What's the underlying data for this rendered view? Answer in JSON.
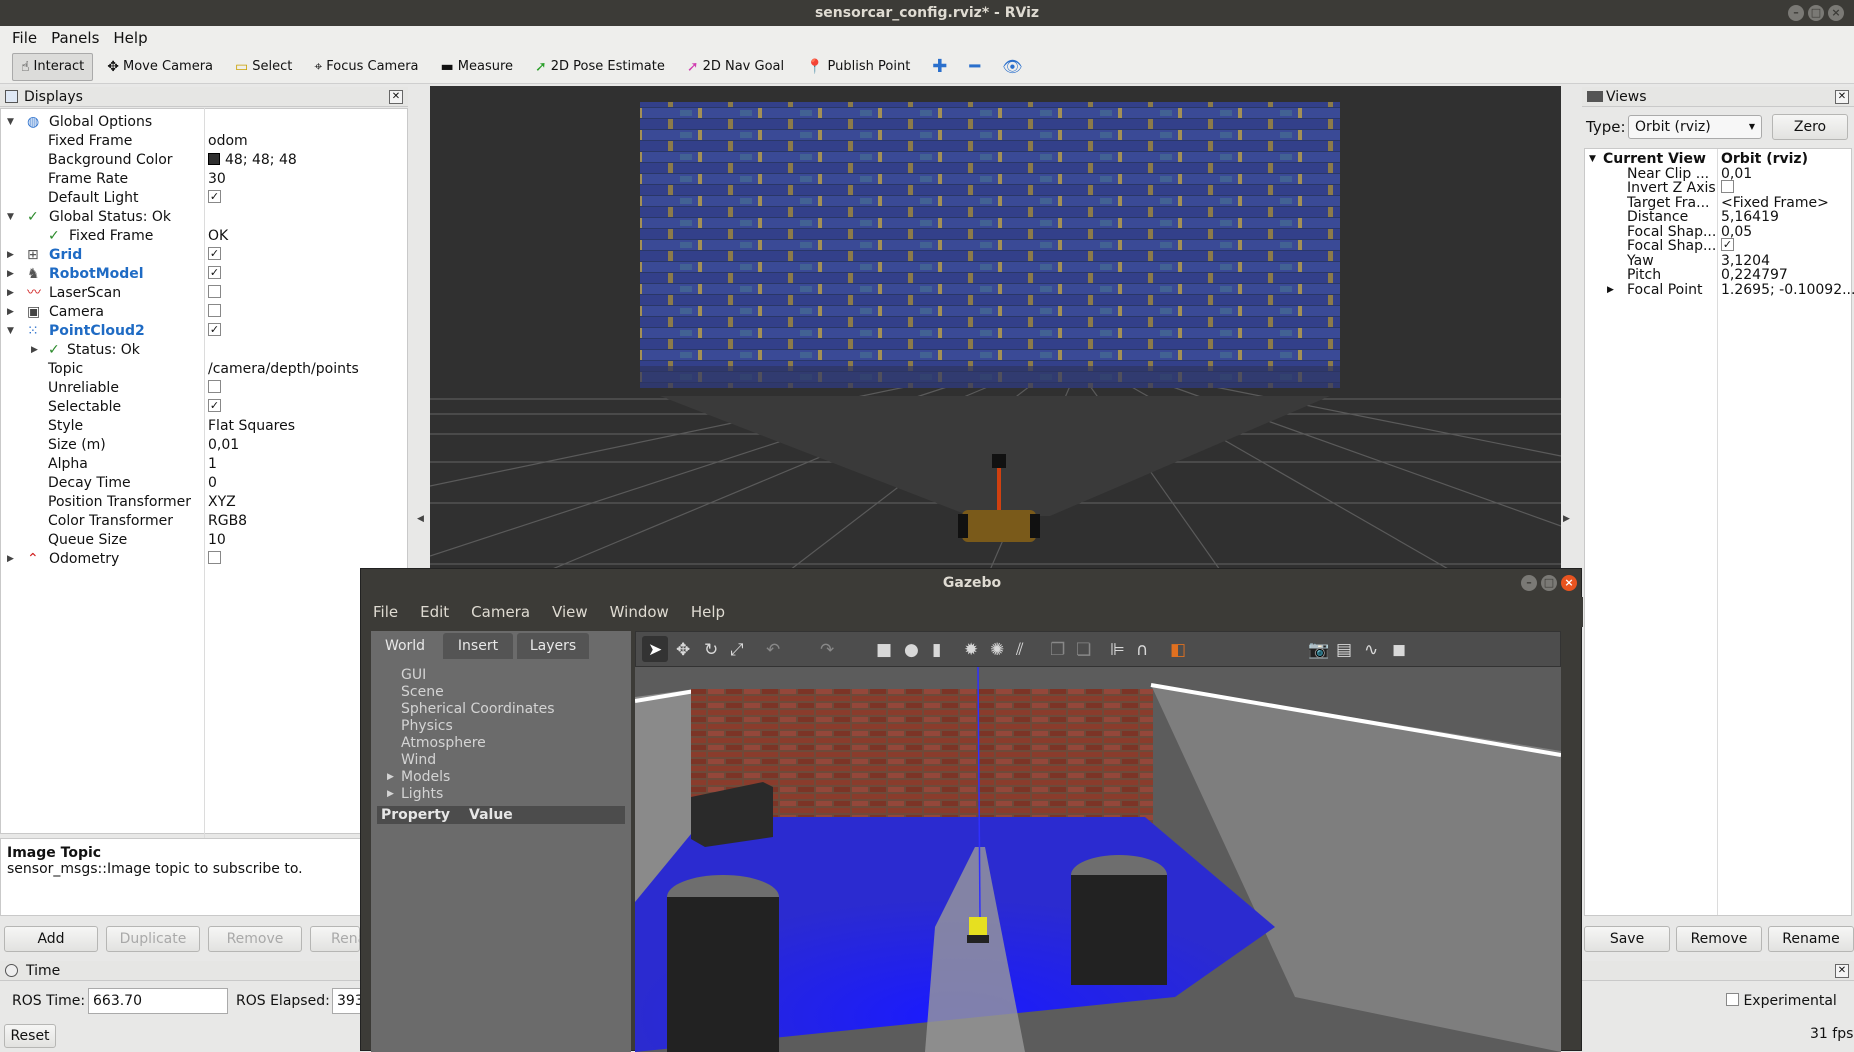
{
  "window": {
    "title": "sensorcar_config.rviz* - RViz"
  },
  "menu": [
    "File",
    "Panels",
    "Help"
  ],
  "toolbar": [
    {
      "label": "Interact",
      "icon": "cursor-icon",
      "active": true
    },
    {
      "label": "Move Camera",
      "icon": "move-icon"
    },
    {
      "label": "Select",
      "icon": "select-icon"
    },
    {
      "label": "Focus Camera",
      "icon": "focus-icon"
    },
    {
      "label": "Measure",
      "icon": "ruler-icon"
    },
    {
      "label": "2D Pose Estimate",
      "icon": "green-arrow-icon"
    },
    {
      "label": "2D Nav Goal",
      "icon": "pink-arrow-icon"
    },
    {
      "label": "Publish Point",
      "icon": "pin-icon"
    }
  ],
  "displays": {
    "title": "Displays",
    "rows": [
      {
        "label": "Global Options",
        "value": "",
        "indent": 0,
        "arrow": "down",
        "icon": "globe-icon"
      },
      {
        "label": "Fixed Frame",
        "value": "odom",
        "indent": 1
      },
      {
        "label": "Background Color",
        "value": "48; 48; 48",
        "indent": 1,
        "swatch": "#303030"
      },
      {
        "label": "Frame Rate",
        "value": "30",
        "indent": 1
      },
      {
        "label": "Default Light",
        "value": "",
        "indent": 1,
        "check": true
      },
      {
        "label": "Global Status: Ok",
        "value": "",
        "indent": 0,
        "arrow": "down",
        "status": true
      },
      {
        "label": "Fixed Frame",
        "value": "OK",
        "indent": 2,
        "status": true
      },
      {
        "label": "Grid",
        "value": "",
        "indent": 0,
        "arrow": "right",
        "icon": "grid-icon",
        "blue": true,
        "check": true
      },
      {
        "label": "RobotModel",
        "value": "",
        "indent": 0,
        "arrow": "right",
        "icon": "robot-icon",
        "blue": true,
        "check": true
      },
      {
        "label": "LaserScan",
        "value": "",
        "indent": 0,
        "arrow": "right",
        "icon": "laser-icon",
        "check": false
      },
      {
        "label": "Camera",
        "value": "",
        "indent": 0,
        "arrow": "right",
        "icon": "camera-icon",
        "check": false
      },
      {
        "label": "PointCloud2",
        "value": "",
        "indent": 0,
        "arrow": "down",
        "icon": "pointcloud-icon",
        "blue": true,
        "check": true
      },
      {
        "label": "Status: Ok",
        "value": "",
        "indent": 1,
        "arrow": "right",
        "status": true
      },
      {
        "label": "Topic",
        "value": "/camera/depth/points",
        "indent": 1
      },
      {
        "label": "Unreliable",
        "value": "",
        "indent": 1,
        "check": false
      },
      {
        "label": "Selectable",
        "value": "",
        "indent": 1,
        "check": true
      },
      {
        "label": "Style",
        "value": "Flat Squares",
        "indent": 1
      },
      {
        "label": "Size (m)",
        "value": "0,01",
        "indent": 1
      },
      {
        "label": "Alpha",
        "value": "1",
        "indent": 1
      },
      {
        "label": "Decay Time",
        "value": "0",
        "indent": 1
      },
      {
        "label": "Position Transformer",
        "value": "XYZ",
        "indent": 1
      },
      {
        "label": "Color Transformer",
        "value": "RGB8",
        "indent": 1
      },
      {
        "label": "Queue Size",
        "value": "10",
        "indent": 1
      },
      {
        "label": "Odometry",
        "value": "",
        "indent": 0,
        "arrow": "right",
        "icon": "odometry-icon",
        "check": false
      }
    ],
    "desc_title": "Image Topic",
    "desc_text": "sensor_msgs::Image topic to subscribe to.",
    "buttons": [
      "Add",
      "Duplicate",
      "Remove",
      "Rena"
    ]
  },
  "views": {
    "title": "Views",
    "type_label": "Type:",
    "type_value": "Orbit (rviz)",
    "zero": "Zero",
    "rows": [
      {
        "label": "Current View",
        "value": "Orbit (rviz)",
        "bold": true,
        "arrow": "down"
      },
      {
        "label": "Near Clip ...",
        "value": "0,01"
      },
      {
        "label": "Invert Z Axis",
        "value": "",
        "check": false
      },
      {
        "label": "Target Fra...",
        "value": "<Fixed Frame>"
      },
      {
        "label": "Distance",
        "value": "5,16419"
      },
      {
        "label": "Focal Shap...",
        "value": "0,05"
      },
      {
        "label": "Focal Shap...",
        "value": "",
        "check": true
      },
      {
        "label": "Yaw",
        "value": "3,1204"
      },
      {
        "label": "Pitch",
        "value": "0,224797"
      },
      {
        "label": "Focal Point",
        "value": "1.2695; -0.10092...",
        "arrow": "right"
      }
    ],
    "buttons": [
      "Save",
      "Remove",
      "Rename"
    ]
  },
  "time": {
    "title": "Time",
    "ros_time_label": "ROS Time:",
    "ros_time": "663.70",
    "ros_elapsed_label": "ROS Elapsed:",
    "ros_elapsed": "393",
    "experimental": "Experimental",
    "reset": "Reset",
    "fps": "31 fps"
  },
  "gazebo": {
    "title": "Gazebo",
    "menu": [
      "File",
      "Edit",
      "Camera",
      "View",
      "Window",
      "Help"
    ],
    "tabs": [
      "World",
      "Insert",
      "Layers"
    ],
    "world_items": [
      "GUI",
      "Scene",
      "Spherical Coordinates",
      "Physics",
      "Atmosphere",
      "Wind",
      "Models",
      "Lights"
    ],
    "prop_header": "Property",
    "value_header": "Value"
  }
}
